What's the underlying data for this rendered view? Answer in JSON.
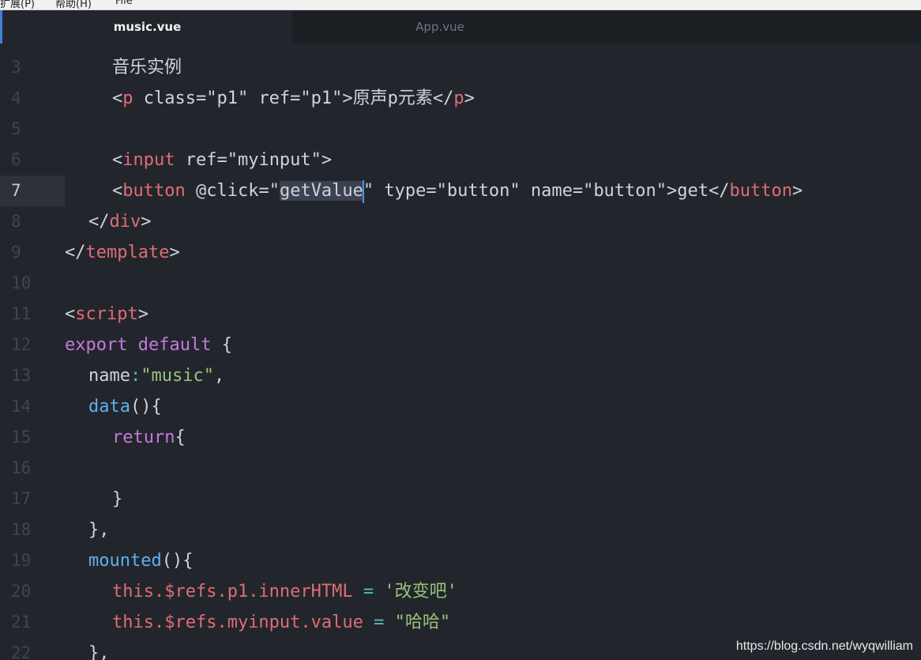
{
  "menubar": {
    "items": [
      "扩展(P)",
      "帮助(H)",
      "File"
    ]
  },
  "tabs": [
    {
      "label": "music.vue",
      "active": true
    },
    {
      "label": "App.vue",
      "active": false
    }
  ],
  "editor": {
    "active_line": 7,
    "lines": [
      {
        "number": "3",
        "segments": [
          {
            "t": "音乐实例",
            "c": "plain"
          }
        ]
      },
      {
        "number": "4",
        "segments": [
          {
            "t": "<",
            "c": "punc"
          },
          {
            "t": "p",
            "c": "tag"
          },
          {
            "t": " class=\"p1\" ref=\"p1\">原声p元素</",
            "c": "plain"
          },
          {
            "t": "p",
            "c": "tag"
          },
          {
            "t": ">",
            "c": "punc"
          }
        ]
      },
      {
        "number": "5",
        "segments": []
      },
      {
        "number": "6",
        "segments": [
          {
            "t": "<",
            "c": "punc"
          },
          {
            "t": "input",
            "c": "tag"
          },
          {
            "t": " ref=\"myinput\">",
            "c": "plain"
          }
        ]
      },
      {
        "number": "7",
        "segments": [
          {
            "t": "<",
            "c": "punc"
          },
          {
            "t": "button",
            "c": "tag"
          },
          {
            "t": " @click=\"",
            "c": "plain"
          },
          {
            "t": "getValue",
            "c": "sel"
          },
          {
            "t": "\" type=\"button\" name=\"button\">get</",
            "c": "plain"
          },
          {
            "t": "button",
            "c": "tag"
          },
          {
            "t": ">",
            "c": "punc"
          }
        ]
      },
      {
        "number": "8",
        "segments": [
          {
            "t": "</",
            "c": "punc"
          },
          {
            "t": "div",
            "c": "tag"
          },
          {
            "t": ">",
            "c": "punc"
          }
        ]
      },
      {
        "number": "9",
        "segments": [
          {
            "t": "</",
            "c": "punc"
          },
          {
            "t": "template",
            "c": "tag"
          },
          {
            "t": ">",
            "c": "punc"
          }
        ]
      },
      {
        "number": "10",
        "segments": []
      },
      {
        "number": "11",
        "segments": [
          {
            "t": "<",
            "c": "punc"
          },
          {
            "t": "script",
            "c": "tag"
          },
          {
            "t": ">",
            "c": "punc"
          }
        ]
      },
      {
        "number": "12",
        "segments": [
          {
            "t": "export",
            "c": "kw"
          },
          {
            "t": " ",
            "c": "plain"
          },
          {
            "t": "default",
            "c": "kw"
          },
          {
            "t": " {",
            "c": "plain"
          }
        ]
      },
      {
        "number": "13",
        "segments": [
          {
            "t": "name",
            "c": "plain"
          },
          {
            "t": ":",
            "c": "op"
          },
          {
            "t": "\"music\"",
            "c": "green"
          },
          {
            "t": ",",
            "c": "plain"
          }
        ]
      },
      {
        "number": "14",
        "segments": [
          {
            "t": "data",
            "c": "blue"
          },
          {
            "t": "(){",
            "c": "plain"
          }
        ]
      },
      {
        "number": "15",
        "segments": [
          {
            "t": "return",
            "c": "kw"
          },
          {
            "t": "{",
            "c": "plain"
          }
        ]
      },
      {
        "number": "16",
        "segments": []
      },
      {
        "number": "17",
        "segments": [
          {
            "t": "}",
            "c": "plain"
          }
        ]
      },
      {
        "number": "18",
        "segments": [
          {
            "t": "},",
            "c": "plain"
          }
        ]
      },
      {
        "number": "19",
        "segments": [
          {
            "t": "mounted",
            "c": "blue"
          },
          {
            "t": "(){",
            "c": "plain"
          }
        ]
      },
      {
        "number": "20",
        "segments": [
          {
            "t": "this",
            "c": "red"
          },
          {
            "t": ".$refs.p1.innerHTML",
            "c": "red"
          },
          {
            "t": " = ",
            "c": "op"
          },
          {
            "t": "'改变吧'",
            "c": "green"
          }
        ]
      },
      {
        "number": "21",
        "segments": [
          {
            "t": "this",
            "c": "red"
          },
          {
            "t": ".$refs.myinput.value",
            "c": "red"
          },
          {
            "t": " = ",
            "c": "op"
          },
          {
            "t": "\"哈哈\"",
            "c": "green"
          }
        ]
      },
      {
        "number": "22",
        "segments": [
          {
            "t": "},",
            "c": "plain"
          }
        ]
      }
    ]
  },
  "watermark": "https://blog.csdn.net/wyqwilliam"
}
